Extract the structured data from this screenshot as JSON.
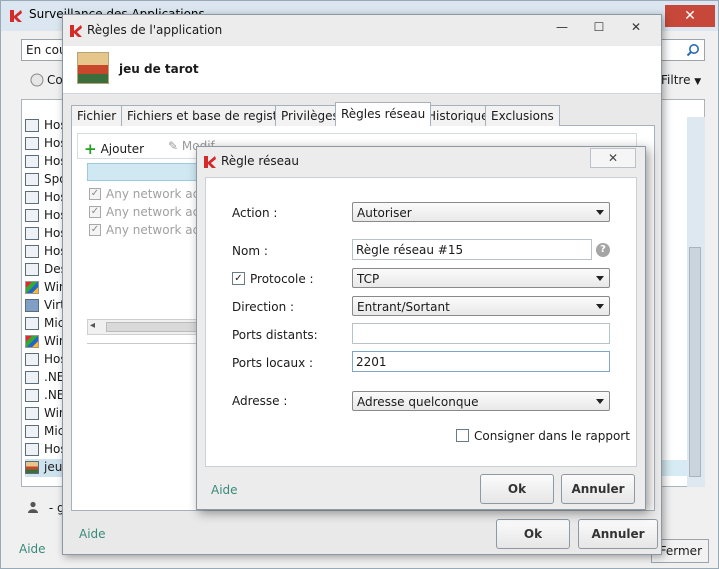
{
  "background_window": {
    "title": "Surveillance des Applications",
    "search_value": "En cou",
    "toolbar_button": "Co",
    "filter_label": "Filtre",
    "app_items": [
      {
        "label": "Hos",
        "icon": "window-icon"
      },
      {
        "label": "Hos",
        "icon": "window-icon"
      },
      {
        "label": "Hos",
        "icon": "window-icon"
      },
      {
        "label": "Spo",
        "icon": "window-icon"
      },
      {
        "label": "Hos",
        "icon": "window-icon"
      },
      {
        "label": "Hos",
        "icon": "window-icon"
      },
      {
        "label": "Hos",
        "icon": "window-icon"
      },
      {
        "label": "Hos",
        "icon": "window-icon"
      },
      {
        "label": "Des",
        "icon": "window-icon"
      },
      {
        "label": "Win",
        "icon": "windows-logo-icon"
      },
      {
        "label": "Virt",
        "icon": "virtualbox-icon"
      },
      {
        "label": "Mic",
        "icon": "window-icon"
      },
      {
        "label": "Win",
        "icon": "windows-logo-icon"
      },
      {
        "label": "Hos",
        "icon": "window-icon"
      },
      {
        "label": ".NE",
        "icon": "window-icon"
      },
      {
        "label": ".NE",
        "icon": "window-icon"
      },
      {
        "label": "Win",
        "icon": "window-icon"
      },
      {
        "label": "Mic",
        "icon": "window-icon"
      },
      {
        "label": "Hos",
        "icon": "window-icon"
      },
      {
        "label": "jeu",
        "icon": "tarot-app-icon",
        "selected": true
      }
    ],
    "user_label": "- gr",
    "aide_label": "Aide",
    "fermer_label": "Fermer",
    "close_symbol": "✕"
  },
  "app_rules_window": {
    "title": "Règles de l'application",
    "app_name": "jeu de tarot",
    "window_buttons": {
      "minimize": "—",
      "maximize": "☐",
      "close": "✕"
    },
    "tabs": [
      {
        "label": "Fichier",
        "active": false
      },
      {
        "label": "Fichiers et base de registres",
        "active": false
      },
      {
        "label": "Privilèges",
        "active": false
      },
      {
        "label": "Règles réseau",
        "active": true
      },
      {
        "label": "Historique",
        "active": false
      },
      {
        "label": "Exclusions",
        "active": false
      }
    ],
    "toolbar": {
      "add_label": "Ajouter",
      "modify_label": "Modif"
    },
    "rules": [
      {
        "label": "Any network activ",
        "checked": true
      },
      {
        "label": "Any network activ",
        "checked": true
      },
      {
        "label": "Any network activ",
        "checked": true
      }
    ],
    "aide_label": "Aide",
    "ok_label": "Ok",
    "cancel_label": "Annuler"
  },
  "network_rule_dialog": {
    "title": "Règle réseau",
    "close_symbol": "✕",
    "action": {
      "label": "Action :",
      "value": "Autoriser"
    },
    "name": {
      "label": "Nom :",
      "value": "Règle réseau #15"
    },
    "protocol": {
      "label": "Protocole :",
      "checked": true,
      "value": "TCP"
    },
    "direction": {
      "label": "Direction :",
      "value": "Entrant/Sortant"
    },
    "remote_ports": {
      "label": "Ports distants:",
      "value": ""
    },
    "local_ports": {
      "label": "Ports locaux :",
      "value": "2201"
    },
    "address": {
      "label": "Adresse :",
      "value": "Adresse quelconque"
    },
    "log": {
      "label": "Consigner dans le rapport",
      "checked": false
    },
    "aide_label": "Aide",
    "ok_label": "Ok",
    "cancel_label": "Annuler"
  },
  "colors": {
    "accent_green": "#3a8a7a",
    "selection": "#cfe8f2",
    "kaspersky_red": "#d32a2a"
  }
}
